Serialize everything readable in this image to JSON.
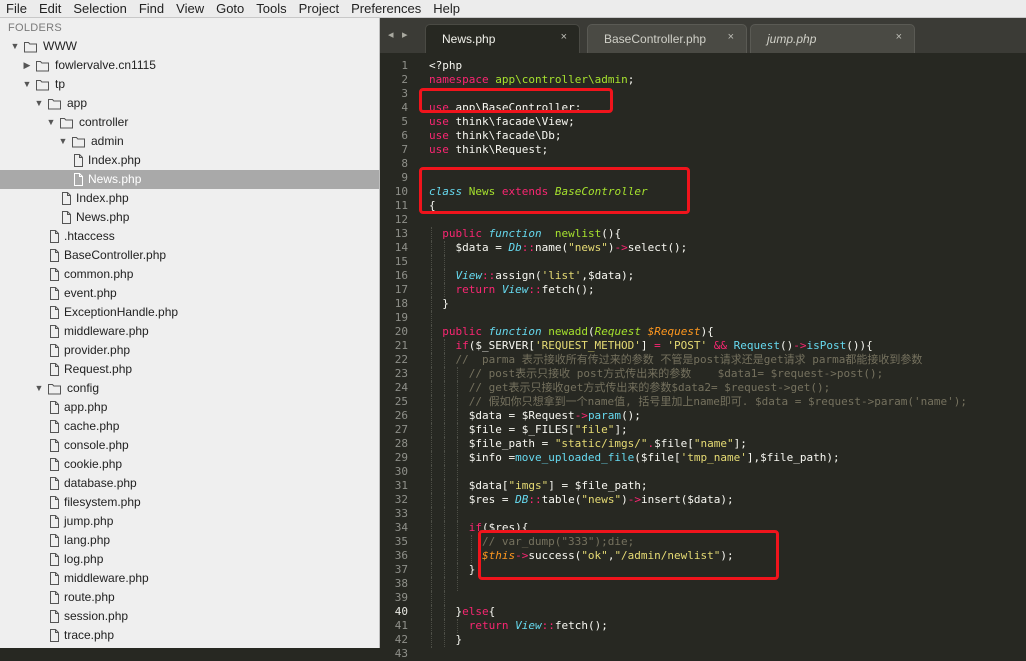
{
  "menu": [
    "File",
    "Edit",
    "Selection",
    "Find",
    "View",
    "Goto",
    "Tools",
    "Project",
    "Preferences",
    "Help"
  ],
  "sidebar": {
    "header": "FOLDERS",
    "items": [
      {
        "label": "WWW",
        "type": "folder",
        "depth": 0,
        "expanded": true
      },
      {
        "label": "fowlervalve.cn1115",
        "type": "folder",
        "depth": 1,
        "expanded": false
      },
      {
        "label": "tp",
        "type": "folder",
        "depth": 1,
        "expanded": true
      },
      {
        "label": "app",
        "type": "folder",
        "depth": 2,
        "expanded": true
      },
      {
        "label": "controller",
        "type": "folder",
        "depth": 3,
        "expanded": true
      },
      {
        "label": "admin",
        "type": "folder",
        "depth": 4,
        "expanded": true
      },
      {
        "label": "Index.php",
        "type": "file",
        "depth": 5
      },
      {
        "label": "News.php",
        "type": "file",
        "depth": 5,
        "selected": true
      },
      {
        "label": "Index.php",
        "type": "file",
        "depth": 4
      },
      {
        "label": "News.php",
        "type": "file",
        "depth": 4
      },
      {
        "label": ".htaccess",
        "type": "file",
        "depth": 3
      },
      {
        "label": "BaseController.php",
        "type": "file",
        "depth": 3
      },
      {
        "label": "common.php",
        "type": "file",
        "depth": 3
      },
      {
        "label": "event.php",
        "type": "file",
        "depth": 3
      },
      {
        "label": "ExceptionHandle.php",
        "type": "file",
        "depth": 3
      },
      {
        "label": "middleware.php",
        "type": "file",
        "depth": 3
      },
      {
        "label": "provider.php",
        "type": "file",
        "depth": 3
      },
      {
        "label": "Request.php",
        "type": "file",
        "depth": 3
      },
      {
        "label": "config",
        "type": "folder",
        "depth": 2,
        "expanded": true
      },
      {
        "label": "app.php",
        "type": "file",
        "depth": 3
      },
      {
        "label": "cache.php",
        "type": "file",
        "depth": 3
      },
      {
        "label": "console.php",
        "type": "file",
        "depth": 3
      },
      {
        "label": "cookie.php",
        "type": "file",
        "depth": 3
      },
      {
        "label": "database.php",
        "type": "file",
        "depth": 3
      },
      {
        "label": "filesystem.php",
        "type": "file",
        "depth": 3
      },
      {
        "label": "jump.php",
        "type": "file",
        "depth": 3
      },
      {
        "label": "lang.php",
        "type": "file",
        "depth": 3
      },
      {
        "label": "log.php",
        "type": "file",
        "depth": 3
      },
      {
        "label": "middleware.php",
        "type": "file",
        "depth": 3
      },
      {
        "label": "route.php",
        "type": "file",
        "depth": 3
      },
      {
        "label": "session.php",
        "type": "file",
        "depth": 3
      },
      {
        "label": "trace.php",
        "type": "file",
        "depth": 3
      }
    ]
  },
  "tabs": [
    {
      "label": "News.php",
      "active": true,
      "italic": false
    },
    {
      "label": "BaseController.php",
      "active": false,
      "italic": false
    },
    {
      "label": "jump.php",
      "active": false,
      "italic": true
    }
  ],
  "tab_nav": {
    "back": "◂",
    "forward": "▸"
  },
  "tab_close_glyph": "×",
  "editor": {
    "current_line": 40,
    "lines": [
      {
        "n": 1,
        "indent": 0,
        "tokens": [
          [
            "t",
            "<?php"
          ]
        ]
      },
      {
        "n": 2,
        "indent": 0,
        "tokens": [
          [
            "k",
            "namespace"
          ],
          [
            "t",
            " "
          ],
          [
            "f",
            "app\\controller\\admin"
          ],
          [
            "t",
            ";"
          ]
        ]
      },
      {
        "n": 3,
        "indent": 0,
        "tokens": []
      },
      {
        "n": 4,
        "indent": 0,
        "tokens": [
          [
            "k",
            "use"
          ],
          [
            "t",
            " app\\BaseController;"
          ]
        ]
      },
      {
        "n": 5,
        "indent": 0,
        "tokens": [
          [
            "k",
            "use"
          ],
          [
            "t",
            " think\\facade\\View;"
          ]
        ]
      },
      {
        "n": 6,
        "indent": 0,
        "tokens": [
          [
            "k",
            "use"
          ],
          [
            "t",
            " think\\facade\\Db;"
          ]
        ]
      },
      {
        "n": 7,
        "indent": 0,
        "tokens": [
          [
            "k",
            "use"
          ],
          [
            "t",
            " think\\Request;"
          ]
        ]
      },
      {
        "n": 8,
        "indent": 0,
        "tokens": []
      },
      {
        "n": 9,
        "indent": 0,
        "tokens": []
      },
      {
        "n": 10,
        "indent": 0,
        "tokens": [
          [
            "s",
            "class"
          ],
          [
            "t",
            " "
          ],
          [
            "f",
            "News"
          ],
          [
            "t",
            " "
          ],
          [
            "k",
            "extends"
          ],
          [
            "t",
            " "
          ],
          [
            "i",
            "BaseController"
          ]
        ]
      },
      {
        "n": 11,
        "indent": 0,
        "tokens": [
          [
            "t",
            "{"
          ]
        ]
      },
      {
        "n": 12,
        "indent": 0,
        "tokens": []
      },
      {
        "n": 13,
        "indent": 1,
        "tokens": [
          [
            "k",
            "public"
          ],
          [
            "t",
            " "
          ],
          [
            "s",
            "function"
          ],
          [
            "t",
            "  "
          ],
          [
            "f",
            "newlist"
          ],
          [
            "t",
            "(){"
          ]
        ]
      },
      {
        "n": 14,
        "indent": 2,
        "tokens": [
          [
            "t",
            "$data = "
          ],
          [
            "s",
            "Db"
          ],
          [
            "k",
            "::"
          ],
          [
            "t",
            "name("
          ],
          [
            "y",
            "\"news\""
          ],
          [
            "t",
            ")"
          ],
          [
            "k",
            "->"
          ],
          [
            "t",
            "select();"
          ]
        ]
      },
      {
        "n": 15,
        "indent": 2,
        "tokens": []
      },
      {
        "n": 16,
        "indent": 2,
        "tokens": [
          [
            "s",
            "View"
          ],
          [
            "k",
            "::"
          ],
          [
            "t",
            "assign("
          ],
          [
            "y",
            "'list'"
          ],
          [
            "t",
            ",$data);"
          ]
        ]
      },
      {
        "n": 17,
        "indent": 2,
        "tokens": [
          [
            "k",
            "return"
          ],
          [
            "t",
            " "
          ],
          [
            "s",
            "View"
          ],
          [
            "k",
            "::"
          ],
          [
            "t",
            "fetch();"
          ]
        ]
      },
      {
        "n": 18,
        "indent": 1,
        "tokens": [
          [
            "t",
            "}"
          ]
        ]
      },
      {
        "n": 19,
        "indent": 1,
        "tokens": []
      },
      {
        "n": 20,
        "indent": 1,
        "tokens": [
          [
            "k",
            "public"
          ],
          [
            "t",
            " "
          ],
          [
            "s",
            "function"
          ],
          [
            "t",
            " "
          ],
          [
            "f",
            "newadd"
          ],
          [
            "t",
            "("
          ],
          [
            "i",
            "Request"
          ],
          [
            "t",
            " "
          ],
          [
            "p",
            "$Request"
          ],
          [
            "t",
            "){"
          ]
        ]
      },
      {
        "n": 21,
        "indent": 2,
        "tokens": [
          [
            "k",
            "if"
          ],
          [
            "t",
            "($_SERVER["
          ],
          [
            "y",
            "'REQUEST_METHOD'"
          ],
          [
            "t",
            "] "
          ],
          [
            "k",
            "="
          ],
          [
            "t",
            " "
          ],
          [
            "y",
            "'POST'"
          ],
          [
            "t",
            " "
          ],
          [
            "k",
            "&&"
          ],
          [
            "t",
            " "
          ],
          [
            "c",
            "Request"
          ],
          [
            "t",
            "()"
          ],
          [
            "k",
            "->"
          ],
          [
            "c",
            "isPost"
          ],
          [
            "t",
            "()){"
          ]
        ]
      },
      {
        "n": 22,
        "indent": 2,
        "tokens": [
          [
            "m",
            "//  parma 表示接收所有传过来的参数 不管是post请求还是get请求 parma都能接收到参数"
          ]
        ]
      },
      {
        "n": 23,
        "indent": 3,
        "tokens": [
          [
            "m",
            "// post表示只接收 post方式传出来的参数    $data1= $request->post();"
          ]
        ]
      },
      {
        "n": 24,
        "indent": 3,
        "tokens": [
          [
            "m",
            "// get表示只接收get方式传出来的参数$data2= $request->get();"
          ]
        ]
      },
      {
        "n": 25,
        "indent": 3,
        "tokens": [
          [
            "m",
            "// 假如你只想拿到一个name值, 括号里加上name即可. $data = $request->param('name');"
          ]
        ]
      },
      {
        "n": 26,
        "indent": 3,
        "tokens": [
          [
            "t",
            "$data = $Request"
          ],
          [
            "k",
            "->"
          ],
          [
            "c",
            "param"
          ],
          [
            "t",
            "();"
          ]
        ]
      },
      {
        "n": 27,
        "indent": 3,
        "tokens": [
          [
            "t",
            "$file = $_FILES["
          ],
          [
            "y",
            "\"file\""
          ],
          [
            "t",
            "];"
          ]
        ]
      },
      {
        "n": 28,
        "indent": 3,
        "tokens": [
          [
            "t",
            "$file_path = "
          ],
          [
            "y",
            "\"static/imgs/\""
          ],
          [
            "k",
            "."
          ],
          [
            "t",
            "$file["
          ],
          [
            "y",
            "\"name\""
          ],
          [
            "t",
            "];"
          ]
        ]
      },
      {
        "n": 29,
        "indent": 3,
        "tokens": [
          [
            "t",
            "$info ="
          ],
          [
            "c",
            "move_uploaded_file"
          ],
          [
            "t",
            "($file["
          ],
          [
            "y",
            "'tmp_name'"
          ],
          [
            "t",
            "],$file_path);"
          ]
        ]
      },
      {
        "n": 30,
        "indent": 3,
        "tokens": []
      },
      {
        "n": 31,
        "indent": 3,
        "tokens": [
          [
            "t",
            "$data["
          ],
          [
            "y",
            "\"imgs\""
          ],
          [
            "t",
            "] = $file_path;"
          ]
        ]
      },
      {
        "n": 32,
        "indent": 3,
        "tokens": [
          [
            "t",
            "$res = "
          ],
          [
            "s",
            "DB"
          ],
          [
            "k",
            "::"
          ],
          [
            "t",
            "table("
          ],
          [
            "y",
            "\"news\""
          ],
          [
            "t",
            ")"
          ],
          [
            "k",
            "->"
          ],
          [
            "t",
            "insert($data);"
          ]
        ]
      },
      {
        "n": 33,
        "indent": 3,
        "tokens": []
      },
      {
        "n": 34,
        "indent": 3,
        "tokens": [
          [
            "k",
            "if"
          ],
          [
            "t",
            "($res){"
          ]
        ]
      },
      {
        "n": 35,
        "indent": 4,
        "tokens": [
          [
            "m",
            "// var_dump(\"333\");die;"
          ]
        ]
      },
      {
        "n": 36,
        "indent": 4,
        "tokens": [
          [
            "p",
            "$this"
          ],
          [
            "k",
            "->"
          ],
          [
            "t",
            "success("
          ],
          [
            "y",
            "\"ok\""
          ],
          [
            "t",
            ","
          ],
          [
            "y",
            "\"/admin/newlist\""
          ],
          [
            "t",
            ");"
          ]
        ]
      },
      {
        "n": 37,
        "indent": 3,
        "tokens": [
          [
            "t",
            "}"
          ]
        ]
      },
      {
        "n": 38,
        "indent": 3,
        "tokens": []
      },
      {
        "n": 39,
        "indent": 2,
        "tokens": []
      },
      {
        "n": 40,
        "indent": 2,
        "tokens": [
          [
            "t",
            "}"
          ],
          [
            "k",
            "else"
          ],
          [
            "t",
            "{"
          ]
        ]
      },
      {
        "n": 41,
        "indent": 3,
        "tokens": [
          [
            "k",
            "return"
          ],
          [
            "t",
            " "
          ],
          [
            "s",
            "View"
          ],
          [
            "k",
            "::"
          ],
          [
            "t",
            "fetch();"
          ]
        ]
      },
      {
        "n": 42,
        "indent": 2,
        "tokens": [
          [
            "t",
            "}"
          ]
        ]
      },
      {
        "n": 43,
        "indent": 1,
        "tokens": [
          [
            "t",
            "}"
          ]
        ]
      }
    ]
  },
  "annotation_color": "#f0141c"
}
